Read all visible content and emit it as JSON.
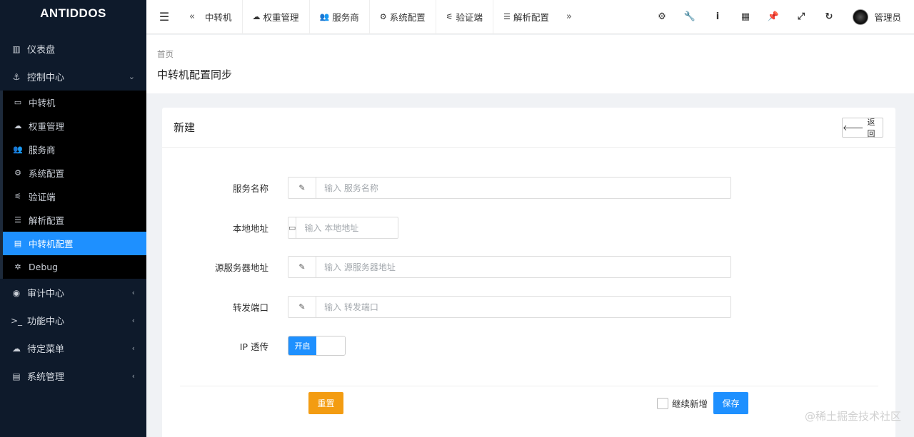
{
  "sidebar": {
    "logo": "ANTIDDOS",
    "items": [
      {
        "label": "仪表盘",
        "icon": "bar-chart-icon",
        "glyph": "▥"
      },
      {
        "label": "控制中心",
        "icon": "anchor-icon",
        "glyph": "⚓",
        "arrow": "⌄"
      }
    ],
    "sub_items": [
      {
        "label": "中转机",
        "icon": "desktop-icon",
        "glyph": "▭"
      },
      {
        "label": "权重管理",
        "icon": "cloud-icon",
        "glyph": "☁"
      },
      {
        "label": "服务商",
        "icon": "users-icon",
        "glyph": "👥"
      },
      {
        "label": "系统配置",
        "icon": "gear-icon",
        "glyph": "⚙"
      },
      {
        "label": "验证端",
        "icon": "sliders-icon",
        "glyph": "⚟"
      },
      {
        "label": "解析配置",
        "icon": "list-icon",
        "glyph": "☰"
      },
      {
        "label": "中转机配置",
        "icon": "file-icon",
        "glyph": "▤",
        "active": true
      },
      {
        "label": "Debug",
        "icon": "bug-icon",
        "glyph": "✲"
      }
    ],
    "items_after": [
      {
        "label": "审计中心",
        "icon": "eye-icon",
        "glyph": "◉",
        "arrow": "‹"
      },
      {
        "label": "功能中心",
        "icon": "terminal-icon",
        "glyph": ">_",
        "arrow": "‹"
      },
      {
        "label": "待定菜单",
        "icon": "cloud-icon",
        "glyph": "☁",
        "arrow": "‹"
      },
      {
        "label": "系统管理",
        "icon": "server-icon",
        "glyph": "▤",
        "arrow": "‹"
      }
    ]
  },
  "topbar": {
    "menu_glyph": "☰",
    "prev_glyph": "«",
    "next_glyph": "»",
    "tabs": [
      {
        "label": "中转机",
        "icon": "",
        "glyph": ""
      },
      {
        "label": "权重管理",
        "icon": "cloud-icon",
        "glyph": "☁"
      },
      {
        "label": "服务商",
        "icon": "users-icon",
        "glyph": "👥"
      },
      {
        "label": "系统配置",
        "icon": "gear-icon",
        "glyph": "⚙"
      },
      {
        "label": "验证端",
        "icon": "sliders-icon",
        "glyph": "⚟"
      },
      {
        "label": "解析配置",
        "icon": "list-icon",
        "glyph": "☰"
      }
    ],
    "tools": [
      {
        "icon": "gear-icon",
        "glyph": "⚙"
      },
      {
        "icon": "wrench-icon",
        "glyph": "🔧"
      },
      {
        "icon": "info-icon",
        "glyph": "i"
      },
      {
        "icon": "grid-icon",
        "glyph": "▦"
      },
      {
        "icon": "pin-icon",
        "glyph": "📌"
      },
      {
        "icon": "fullscreen-icon",
        "glyph": "⤢"
      },
      {
        "icon": "refresh-icon",
        "glyph": "↻"
      }
    ],
    "user_name": "管理员"
  },
  "page": {
    "breadcrumb": "首页",
    "title": "中转机配置同步"
  },
  "card": {
    "title": "新建",
    "back_label": "返回",
    "back_glyph": "🡐"
  },
  "form": {
    "fields": [
      {
        "label": "服务名称",
        "icon": "pencil-icon",
        "glyph": "✎",
        "placeholder": "输入 服务名称"
      },
      {
        "label": "本地地址",
        "icon": "laptop-icon",
        "glyph": "▭",
        "placeholder": "输入 本地地址"
      },
      {
        "label": "源服务器地址",
        "icon": "pencil-icon",
        "glyph": "✎",
        "placeholder": "输入 源服务器地址"
      },
      {
        "label": "转发端口",
        "icon": "pencil-icon",
        "glyph": "✎",
        "placeholder": "输入 转发端口"
      }
    ],
    "ip_label": "IP 透传",
    "switch_on_label": "开启",
    "reset_label": "重置",
    "continue_label": "继续新增",
    "save_label": "保存"
  },
  "watermark": "@稀土掘金技术社区",
  "colors": {
    "sidebar_bg": "#0e1a2b",
    "active": "#1e90ff",
    "reset": "#f39c12",
    "save": "#1e90ff"
  }
}
